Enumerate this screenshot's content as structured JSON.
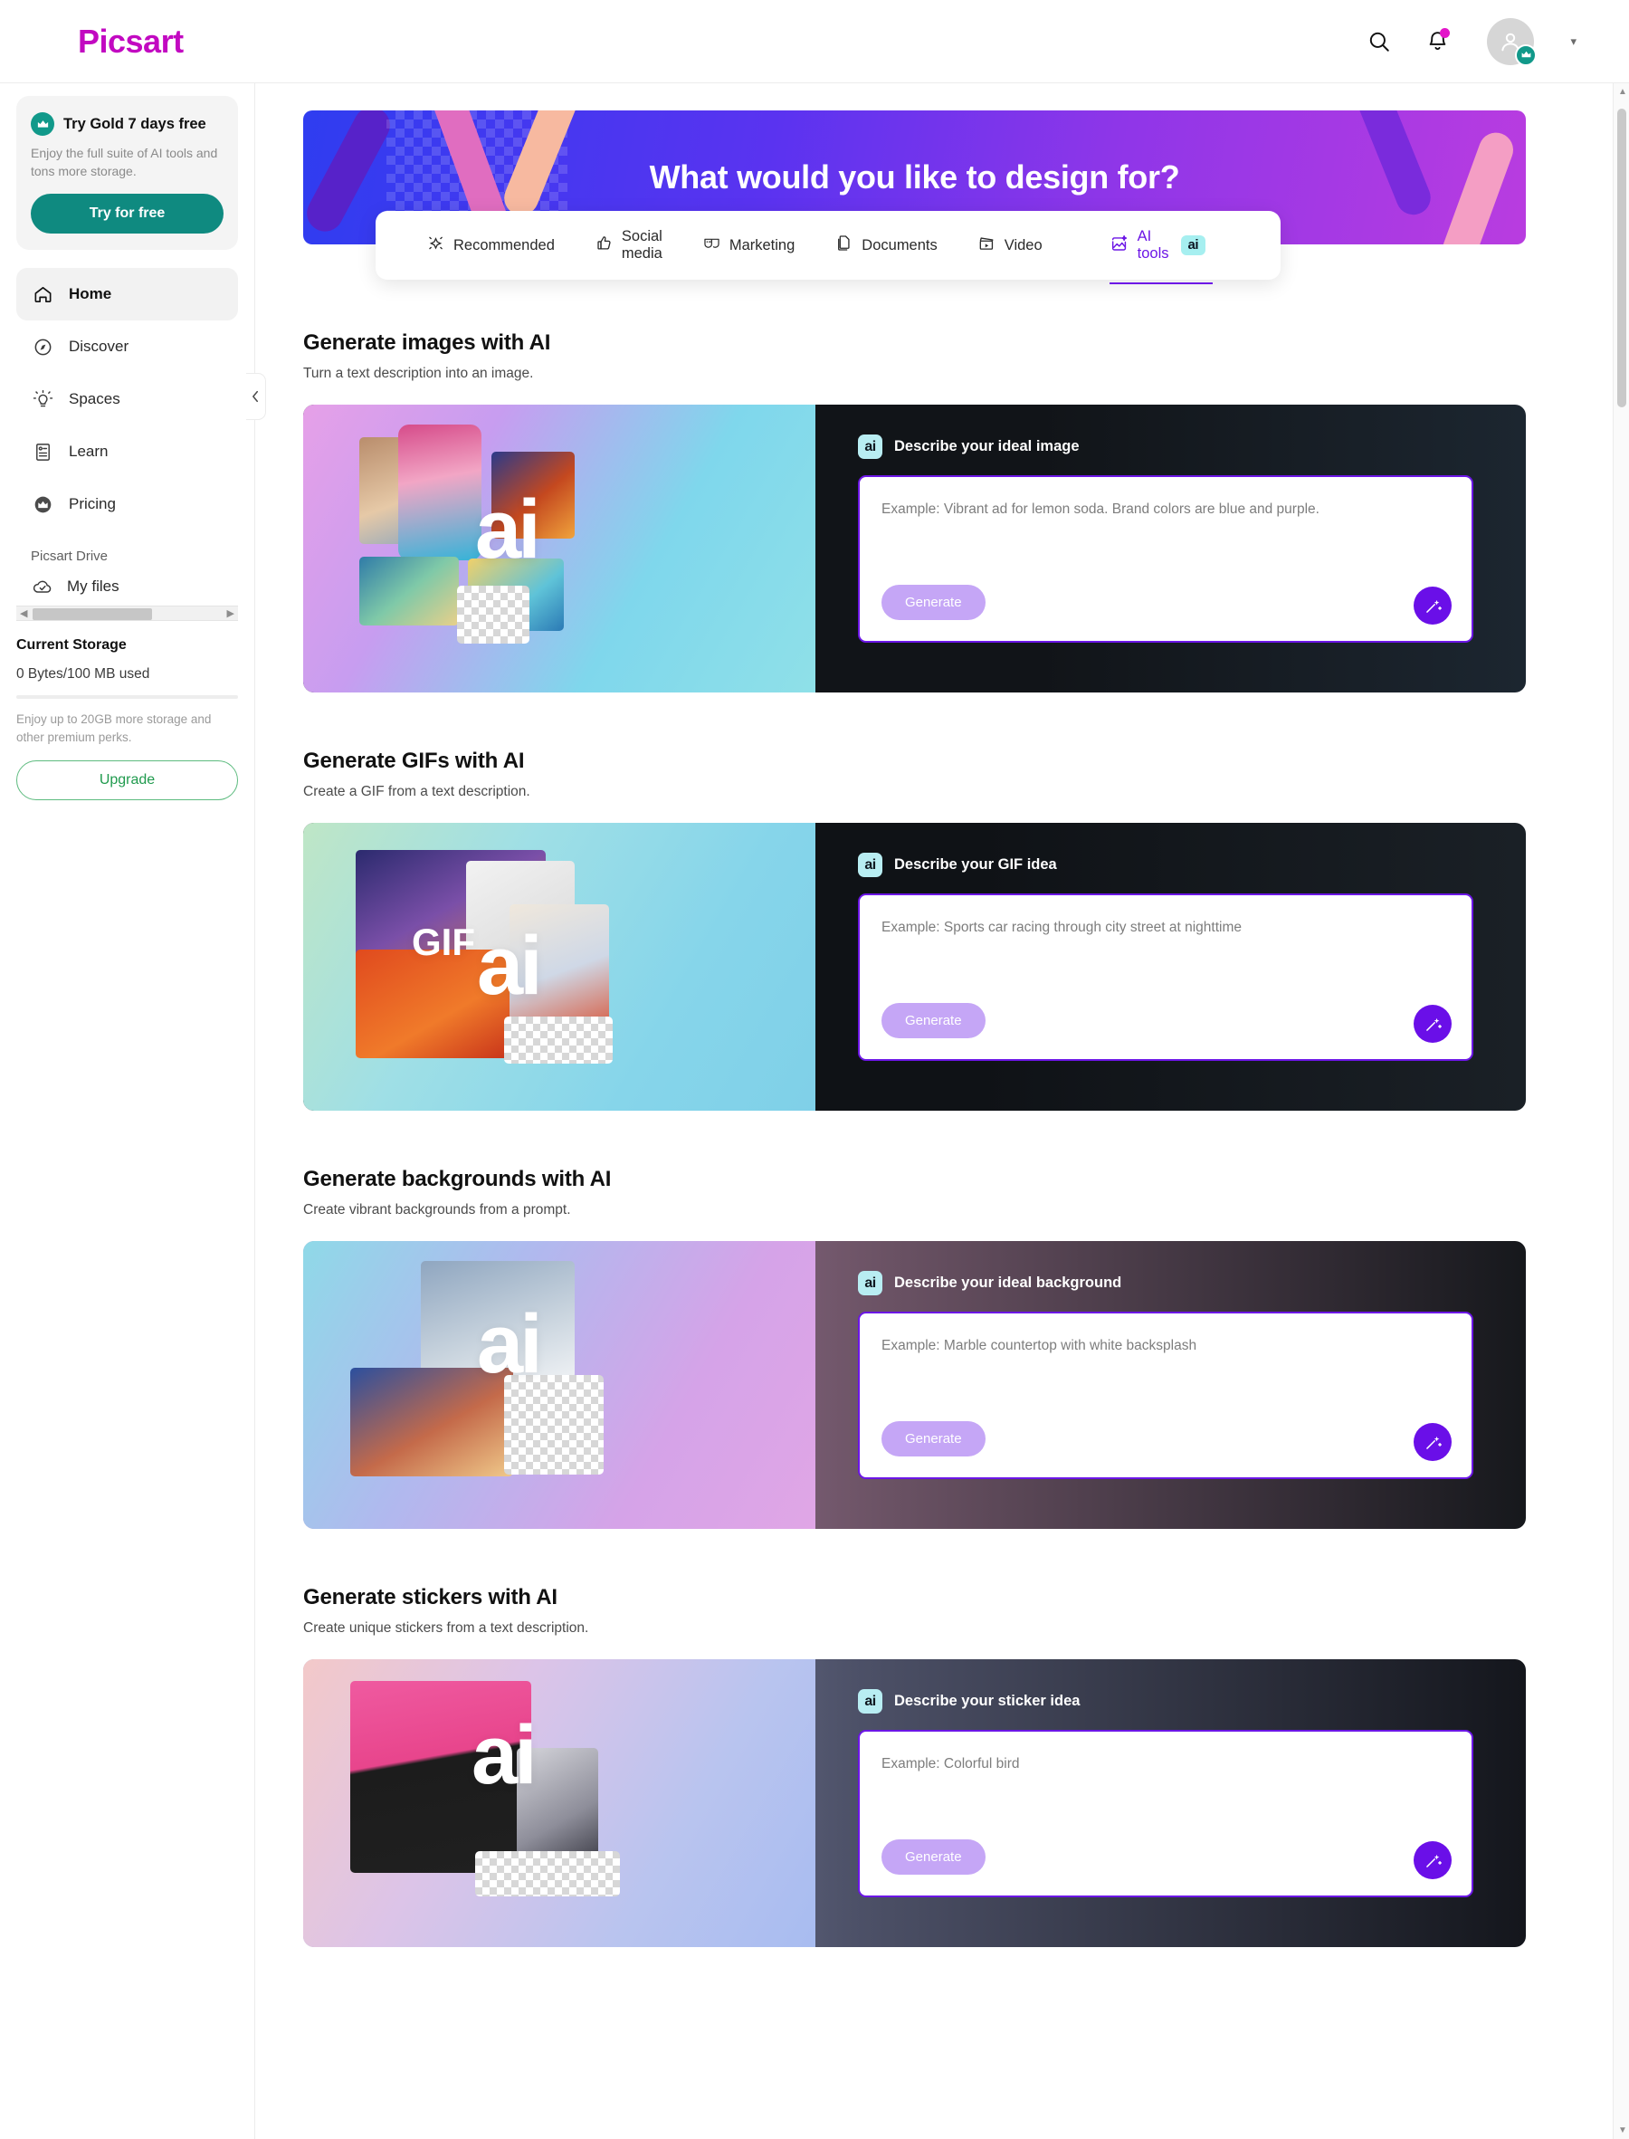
{
  "header": {
    "logo": "Picsart",
    "search_icon": "search-icon",
    "notifications_icon": "bell-icon",
    "avatar_icon": "avatar",
    "chevron": "▾"
  },
  "sidebar": {
    "gold_card": {
      "title": "Try Gold 7 days free",
      "subtitle": "Enjoy the full suite of AI tools and tons more storage.",
      "button": "Try for free",
      "accent": "#0f8a80"
    },
    "items": [
      {
        "label": "Home",
        "icon": "home-icon",
        "active": true
      },
      {
        "label": "Discover",
        "icon": "compass-icon",
        "active": false
      },
      {
        "label": "Spaces",
        "icon": "bulb-icon",
        "active": false
      },
      {
        "label": "Learn",
        "icon": "article-icon",
        "active": false
      },
      {
        "label": "Pricing",
        "icon": "crown-icon",
        "active": false
      }
    ],
    "drive": {
      "title": "Picsart Drive",
      "my_files": "My files",
      "storage_title": "Current Storage",
      "storage_value": "0 Bytes/100 MB used",
      "storage_note": "Enjoy up to 20GB more storage and other premium perks.",
      "upgrade_label": "Upgrade",
      "upgrade_color": "#1f9a4d"
    },
    "collapse_icon": "chevron-left-icon"
  },
  "hero": {
    "title": "What would you like to design for?"
  },
  "tabs": [
    {
      "label": "Recommended",
      "icon": "sparkle-icon",
      "active": false
    },
    {
      "label": "Social media",
      "icon": "thumbs-up-icon",
      "active": false
    },
    {
      "label": "Marketing",
      "icon": "masks-icon",
      "active": false
    },
    {
      "label": "Documents",
      "icon": "document-icon",
      "active": false
    },
    {
      "label": "Video",
      "icon": "clapper-icon",
      "active": false
    },
    {
      "label": "AI tools",
      "icon": "ai-image-icon",
      "active": true,
      "badge": "ai"
    }
  ],
  "sections": [
    {
      "title": "Generate images with AI",
      "subtitle": "Turn a text description into an image.",
      "prompt_label": "Describe your ideal image",
      "badge": "ai",
      "placeholder": "Example: Vibrant ad for lemon soda. Brand colors are blue and purple.",
      "generate": "Generate",
      "wand_icon": "magic-wand-icon",
      "collage_word": "ai",
      "panel_gradient": "linear-gradient(90deg,#111418 60%,#1c2630 100%)",
      "collage_gradient": "linear-gradient(120deg,#e6a0e8 0%,#c79df0 30%,#7fd7ec 65%,#8fe0e8 100%)"
    },
    {
      "title": "Generate GIFs with AI",
      "subtitle": "Create a GIF from a text description.",
      "prompt_label": "Describe your GIF idea",
      "badge": "ai",
      "placeholder": "Example: Sports car racing through city street at nighttime",
      "generate": "Generate",
      "wand_icon": "magic-wand-icon",
      "collage_word": "ai",
      "collage_sub_word": "GIF",
      "panel_gradient": "linear-gradient(90deg,#0f1216 55%,#1a2026 100%)",
      "collage_gradient": "linear-gradient(120deg,#bfe6c6 0%,#9fdfe6 35%,#86d5ea 70%,#7fd0e8 100%)"
    },
    {
      "title": "Generate backgrounds with AI",
      "subtitle": "Create vibrant backgrounds from a prompt.",
      "prompt_label": "Describe your ideal background",
      "badge": "ai",
      "placeholder": "Example: Marble countertop with white backsplash",
      "generate": "Generate",
      "wand_icon": "magic-wand-icon",
      "collage_word": "ai",
      "panel_gradient": "linear-gradient(90deg,#b98ec0 0%,#6f5568 45%,#16181c 100%)",
      "collage_gradient": "linear-gradient(120deg,#8fd9e8 0%,#b0b9ee 35%,#d5a3e8 70%,#e0a6e6 100%)"
    },
    {
      "title": "Generate stickers with AI",
      "subtitle": "Create unique stickers from a text description.",
      "prompt_label": "Describe your sticker idea",
      "badge": "ai",
      "placeholder": "Example: Colorful bird",
      "generate": "Generate",
      "wand_icon": "magic-wand-icon",
      "collage_word": "ai",
      "panel_gradient": "linear-gradient(90deg,#9aa2c4 0%,#4d5168 45%,#14161c 100%)",
      "collage_gradient": "linear-gradient(120deg,#f3c9c9 0%,#dcc4e8 35%,#b9c4ef 70%,#a8bcf0 100%)"
    }
  ],
  "colors": {
    "brand": "#c209c1",
    "purple": "#6c16e6",
    "teal": "#0f8a80",
    "green": "#1f9a4d"
  }
}
